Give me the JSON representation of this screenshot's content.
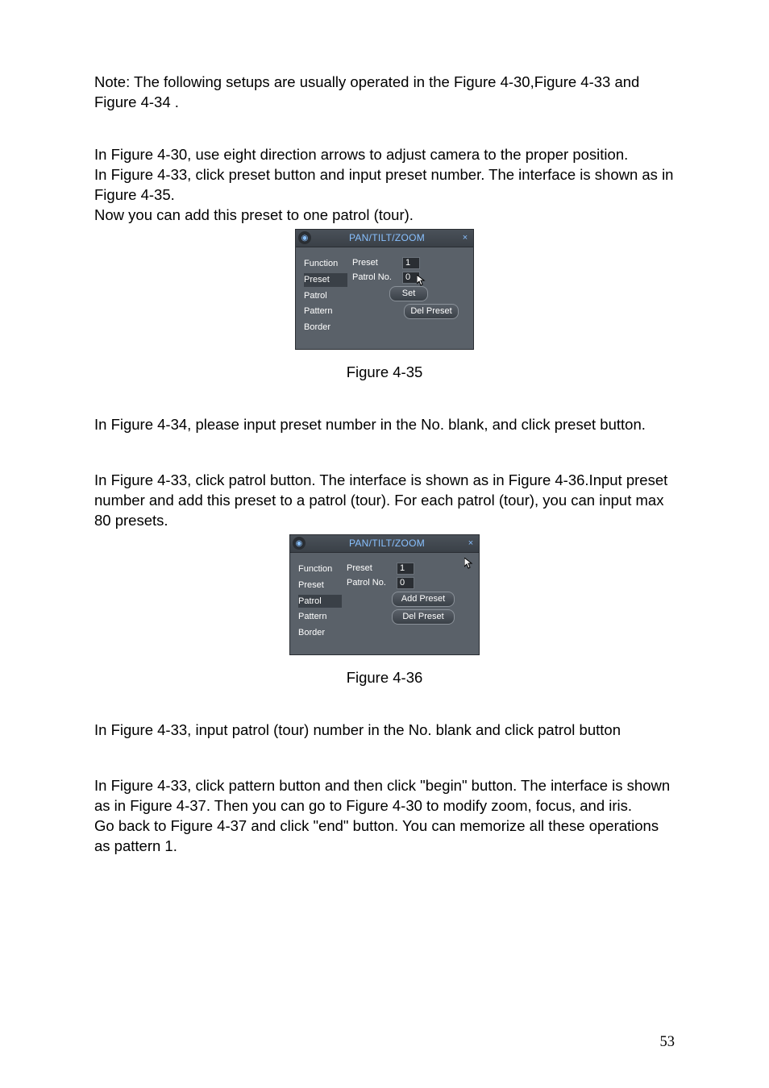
{
  "paragraphs": {
    "p1": "Note: The following setups are usually operated in the Figure 4-30,Figure 4-33 and Figure 4-34 .",
    "p2a": "In Figure 4-30, use eight direction arrows to adjust camera to the proper position.",
    "p2b": "In Figure 4-33, click preset button and input preset number. The interface is shown as in Figure 4-35.",
    "p2c": "Now you can add this preset to one patrol (tour).",
    "p3": "In Figure 4-34, please input preset number in the No. blank, and click preset button.",
    "p4": "In Figure 4-33, click patrol button. The interface is shown as in Figure 4-36.Input preset number and add this preset to a patrol (tour). For each patrol (tour), you can input max 80 presets.",
    "p5": "In Figure 4-33, input patrol (tour) number in the No. blank and click patrol button",
    "p6a": "In Figure 4-33, click pattern button and then click \"begin\" button. The interface is shown as in Figure 4-37. Then you can go to Figure 4-30 to modify zoom, focus, and iris.",
    "p6b": "Go back to Figure 4-37 and click \"end\" button. You can memorize all these operations as pattern 1."
  },
  "captions": {
    "fig35": "Figure 4-35",
    "fig36": "Figure 4-36"
  },
  "dialog35": {
    "title": "PAN/TILT/ZOOM",
    "closeGlyph": "×",
    "functions": [
      "Function",
      "Preset",
      "Patrol",
      "Pattern",
      "Border"
    ],
    "labels": {
      "preset": "Preset",
      "patrolno": "Patrol No."
    },
    "values": {
      "preset": "1",
      "patrolno": "0"
    },
    "buttons": {
      "set": "Set",
      "del": "Del Preset"
    }
  },
  "dialog36": {
    "title": "PAN/TILT/ZOOM",
    "closeGlyph": "×",
    "functions": [
      "Function",
      "Preset",
      "Patrol",
      "Pattern",
      "Border"
    ],
    "labels": {
      "preset": "Preset",
      "patrolno": "Patrol No."
    },
    "values": {
      "preset": "1",
      "patrolno": "0"
    },
    "buttons": {
      "add": "Add Preset",
      "del": "Del Preset"
    }
  },
  "page_number": "53"
}
